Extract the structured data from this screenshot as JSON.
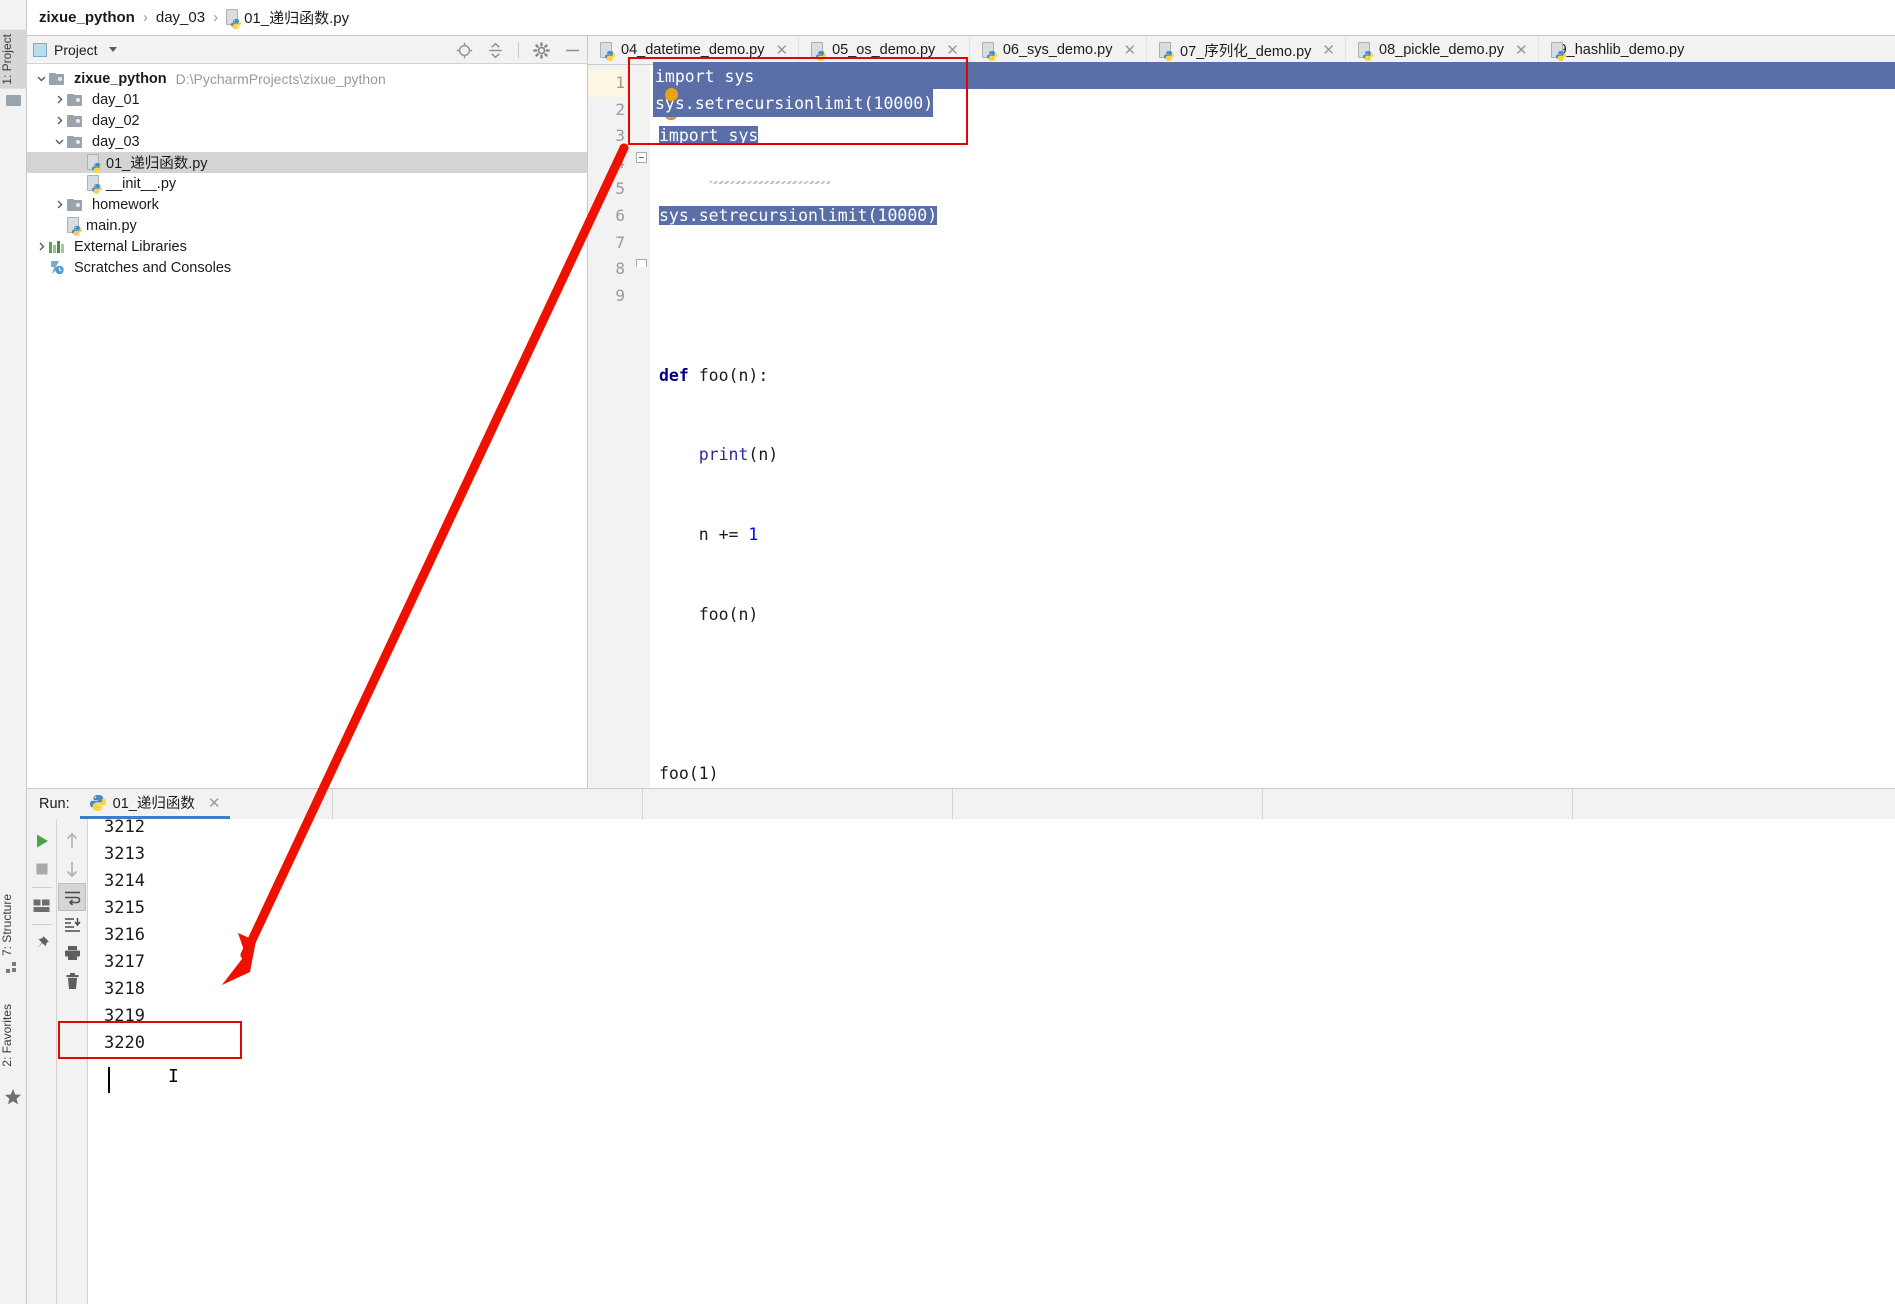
{
  "window": {
    "left_tool_tabs": [
      {
        "label": "1: Project",
        "icon": "project-icon",
        "active": true
      },
      {
        "label": "7: Structure",
        "icon": "structure-icon",
        "active": false
      },
      {
        "label": "2: Favorites",
        "icon": "star-icon",
        "active": false
      }
    ]
  },
  "breadcrumb": {
    "project": "zixue_python",
    "folder": "day_03",
    "file": "01_递归函数.py",
    "separator": "›"
  },
  "project_panel": {
    "title": "Project",
    "toolbar": [
      {
        "name": "locate-icon",
        "tooltip": "Select Opened File"
      },
      {
        "name": "collapse-all-icon",
        "tooltip": "Collapse All"
      },
      {
        "name": "gear-icon",
        "tooltip": "Settings"
      },
      {
        "name": "minimize-icon",
        "tooltip": "Hide"
      }
    ],
    "tree": [
      {
        "label": "zixue_python",
        "secondary": "D:\\PycharmProjects\\zixue_python",
        "kind": "folder",
        "indent": 0,
        "expanded": true,
        "bold": true,
        "selected": false
      },
      {
        "label": "day_01",
        "secondary": "",
        "kind": "folder",
        "indent": 1,
        "expanded": false,
        "bold": false,
        "selected": false
      },
      {
        "label": "day_02",
        "secondary": "",
        "kind": "folder",
        "indent": 1,
        "expanded": false,
        "bold": false,
        "selected": false
      },
      {
        "label": "day_03",
        "secondary": "",
        "kind": "folder",
        "indent": 1,
        "expanded": true,
        "bold": false,
        "selected": false
      },
      {
        "label": "01_递归函数.py",
        "secondary": "",
        "kind": "python",
        "indent": 2,
        "expanded": null,
        "bold": false,
        "selected": true
      },
      {
        "label": "__init__.py",
        "secondary": "",
        "kind": "python",
        "indent": 2,
        "expanded": null,
        "bold": false,
        "selected": false
      },
      {
        "label": "homework",
        "secondary": "",
        "kind": "folder",
        "indent": 1,
        "expanded": false,
        "bold": false,
        "selected": false
      },
      {
        "label": "main.py",
        "secondary": "",
        "kind": "python",
        "indent": 1,
        "expanded": null,
        "bold": false,
        "selected": false
      },
      {
        "label": "External Libraries",
        "secondary": "",
        "kind": "library",
        "indent": 0,
        "expanded": false,
        "bold": false,
        "selected": false
      },
      {
        "label": "Scratches and Consoles",
        "secondary": "",
        "kind": "scratch",
        "indent": 0,
        "expanded": null,
        "bold": false,
        "selected": false
      }
    ]
  },
  "editor": {
    "tabs": [
      {
        "label": "04_datetime_demo.py",
        "closable": true,
        "active": false
      },
      {
        "label": "05_os_demo.py",
        "closable": true,
        "active": false
      },
      {
        "label": "06_sys_demo.py",
        "closable": true,
        "active": false
      },
      {
        "label": "07_序列化_demo.py",
        "closable": true,
        "active": false
      },
      {
        "label": "08_pickle_demo.py",
        "closable": true,
        "active": false
      },
      {
        "label": "09_hashlib_demo.py",
        "closable": false,
        "active": false
      }
    ],
    "line_numbers": [
      "1",
      "2",
      "3",
      "4",
      "5",
      "6",
      "7",
      "8",
      "9"
    ],
    "lines": [
      {
        "n": 1,
        "text": "import sys",
        "selected": true
      },
      {
        "n": 2,
        "text": "sys.setrecursionlimit(10000)",
        "selected": true
      },
      {
        "n": 3,
        "text": "",
        "selected": false
      },
      {
        "n": 4,
        "text": "def foo(n):",
        "selected": false
      },
      {
        "n": 5,
        "text": "    print(n)",
        "selected": false
      },
      {
        "n": 6,
        "text": "    n += 1",
        "selected": false
      },
      {
        "n": 7,
        "text": "    foo(n)",
        "selected": false
      },
      {
        "n": 8,
        "text": "",
        "selected": false
      },
      {
        "n": 9,
        "text": "foo(1)",
        "selected": false
      }
    ],
    "tokens": {
      "import_kw": "import",
      "module_sys": " sys",
      "sys_call": "sys.setrecursionlimit(10000)",
      "def_kw": "def",
      "foo_def": " foo(n):",
      "print_call": "print",
      "print_arg": "(n)",
      "n_incr_name": "n +=",
      "n_incr_val": " 1",
      "foo_recurse": "foo(n)",
      "foo_invoke": "foo(1)"
    },
    "recursion_limit": "10000"
  },
  "run_panel": {
    "label": "Run:",
    "tab_label": "01_递归函数",
    "toolbar_left": [
      {
        "name": "rerun-icon",
        "tooltip": "Rerun"
      },
      {
        "name": "stop-icon",
        "tooltip": "Stop"
      },
      {
        "name": "layout-icon",
        "tooltip": "Layout"
      },
      {
        "name": "pin-icon",
        "tooltip": "Pin Tab"
      }
    ],
    "toolbar_right": [
      {
        "name": "arrow-up-icon",
        "tooltip": "Up the stack trace"
      },
      {
        "name": "arrow-down-icon",
        "tooltip": "Down the stack trace"
      },
      {
        "name": "soft-wrap-icon",
        "tooltip": "Soft-Wrap",
        "active": true
      },
      {
        "name": "scroll-to-end-icon",
        "tooltip": "Scroll to End"
      },
      {
        "name": "print-icon",
        "tooltip": "Print"
      },
      {
        "name": "trash-icon",
        "tooltip": "Clear All"
      }
    ],
    "output": [
      "3212",
      "3213",
      "3214",
      "3215",
      "3216",
      "3217",
      "3218",
      "3219",
      "3220"
    ],
    "highlighted_output": "3220"
  },
  "annotations": {
    "boxes": [
      {
        "name": "code-highlight-box",
        "target": "import sys / sys.setrecursionlimit(10000)"
      },
      {
        "name": "output-highlight-box",
        "target": "3220"
      }
    ],
    "arrow": {
      "name": "red-arrow",
      "from": "code-highlight-box",
      "to": "output-highlight-box"
    }
  },
  "colors": {
    "accent": "#3d7dcc",
    "annotation_red": "#e10600",
    "selection_blue": "#5a6fa8",
    "keyword_navy": "#000080",
    "number_blue": "#0000ff",
    "panel_gray": "#f2f2f2",
    "tree_selected": "#d4d4d4"
  }
}
